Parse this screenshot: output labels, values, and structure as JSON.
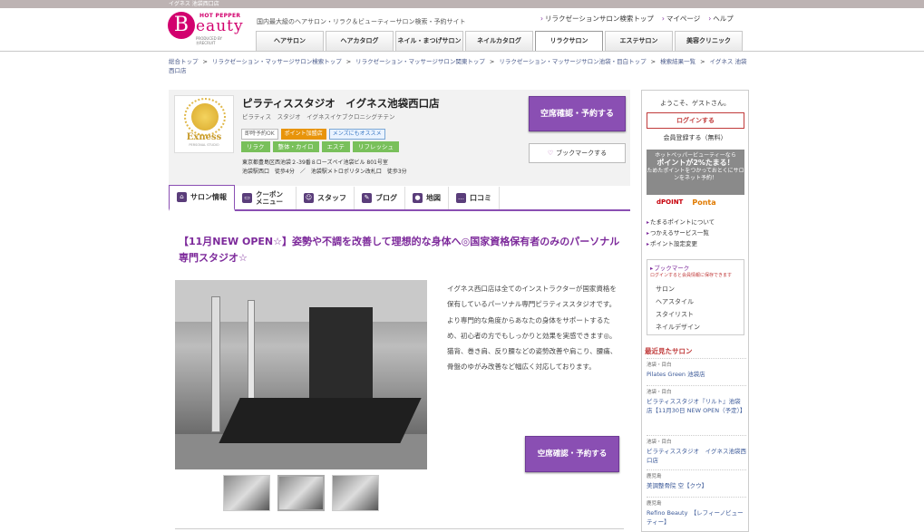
{
  "topbar": {
    "text": "イグネス 池袋西口店"
  },
  "logo": {
    "hp": "HOT PEPPER",
    "b": "B",
    "eauty": "eauty",
    "produced": "PRODUCED BY ⓇRECRUIT"
  },
  "tagline": "国内最大級のヘアサロン・リラク＆ビューティーサロン検索・予約サイト",
  "toplinks": [
    "リラクゼーションサロン検索トップ",
    "マイページ",
    "ヘルプ"
  ],
  "global_tabs": [
    "ヘアサロン",
    "ヘアカタログ",
    "ネイル・まつげサロン",
    "ネイルカタログ",
    "リラクサロン",
    "エステサロン",
    "美容クリニック"
  ],
  "breadcrumb": [
    "総合トップ",
    "リラクゼーション・マッサージサロン検索トップ",
    "リラクゼーション・マッサージサロン関東トップ",
    "リラクゼーション・マッサージサロン池袋・目白トップ",
    "検索結果一覧",
    "イグネス 池袋西口店"
  ],
  "shop": {
    "logo_name": "Exness",
    "logo_sub": "PERSONAL STUDIO",
    "name": "ピラティススタジオ　イグネス池袋西口店",
    "kana": "ピラティス　スタジオ　イグネスイケブクロニシグチテン",
    "tags": [
      "即時予約OK",
      "ポイント加盟店",
      "メンズにもオススメ"
    ],
    "categories": [
      {
        "label": "リラク",
        "color": "#79c05b"
      },
      {
        "label": "整体・カイロ",
        "color": "#79c05b"
      },
      {
        "label": "エステ",
        "color": "#79c05b"
      },
      {
        "label": "リフレッシュ",
        "color": "#79c05b"
      }
    ],
    "address1": "東京都豊島区西池袋２-39番８ローズペイ池袋ビル 801号室",
    "address2": "池袋駅西口　徒歩4分　／　池袋駅メトロポリタン改札口　徒歩3分",
    "reserve_label": "空席確認・予約する",
    "bookmark_label": "ブックマークする"
  },
  "shop_tabs": [
    {
      "icon": "home",
      "label": "サロン情報"
    },
    {
      "icon": "coupon",
      "label": "クーポン メニュー"
    },
    {
      "icon": "staff",
      "label": "スタッフ"
    },
    {
      "icon": "blog",
      "label": "ブログ"
    },
    {
      "icon": "map",
      "label": "地図"
    },
    {
      "icon": "review",
      "label": "口コミ"
    }
  ],
  "catch": "【11月NEW OPEN☆】姿勢や不調を改善して理想的な身体へ◎国家資格保有者のみのパーソナル専門スタジオ☆",
  "description": "イグネス西口店は全てのインストラクターが国家資格を保有しているパーソナル専門ピラティススタジオです。より専門的な角度からあなたの身体をサポートするため、初心者の方でもしっかりと効果を実感できます◎。猫背、巻き肩、反り腰などの姿勢改善や肩こり、腰痛、骨盤のゆがみ改善など幅広く対応しております。",
  "reserve2_label": "空席確認・予約する",
  "sidebar": {
    "welcome": "ようこそ、ゲストさん。",
    "login": "ログインする",
    "register": "会員登録する（無料）",
    "point_text1": "ホットペッパービューティーなら",
    "point_text2": "ポイントが2%たまる！",
    "point_text3": "ためたポイントをつかっておとくにサロンをネット予約！",
    "dpoint": "dPOINT",
    "ponta": "Ponta",
    "links": [
      "たまるポイントについて",
      "つかえるサービス一覧",
      "ポイント設定変更"
    ],
    "bookmark_title": "ブックマーク",
    "bookmark_note": "ログインすると会員情報に保存できます",
    "bookmark_items": [
      "サロン",
      "ヘアスタイル",
      "スタイリスト",
      "ネイルデザイン"
    ],
    "recent_title": "最近見たサロン",
    "recent": [
      {
        "area": "池袋・目白",
        "name": "Pilates Green 池袋店"
      },
      {
        "area": "池袋・目白",
        "name": "ピラティススタジオ『リルト』池袋店【11月30日 NEW OPEN（予定）】"
      },
      {
        "area": "池袋・目白",
        "name": "ピラティススタジオ　イグネス池袋西口店"
      },
      {
        "area": "鹿児島",
        "name": "美調整骨院 空【クウ】"
      },
      {
        "area": "鹿児島",
        "name": "Refino Beauty　【レフィーノビューティー】"
      }
    ]
  }
}
